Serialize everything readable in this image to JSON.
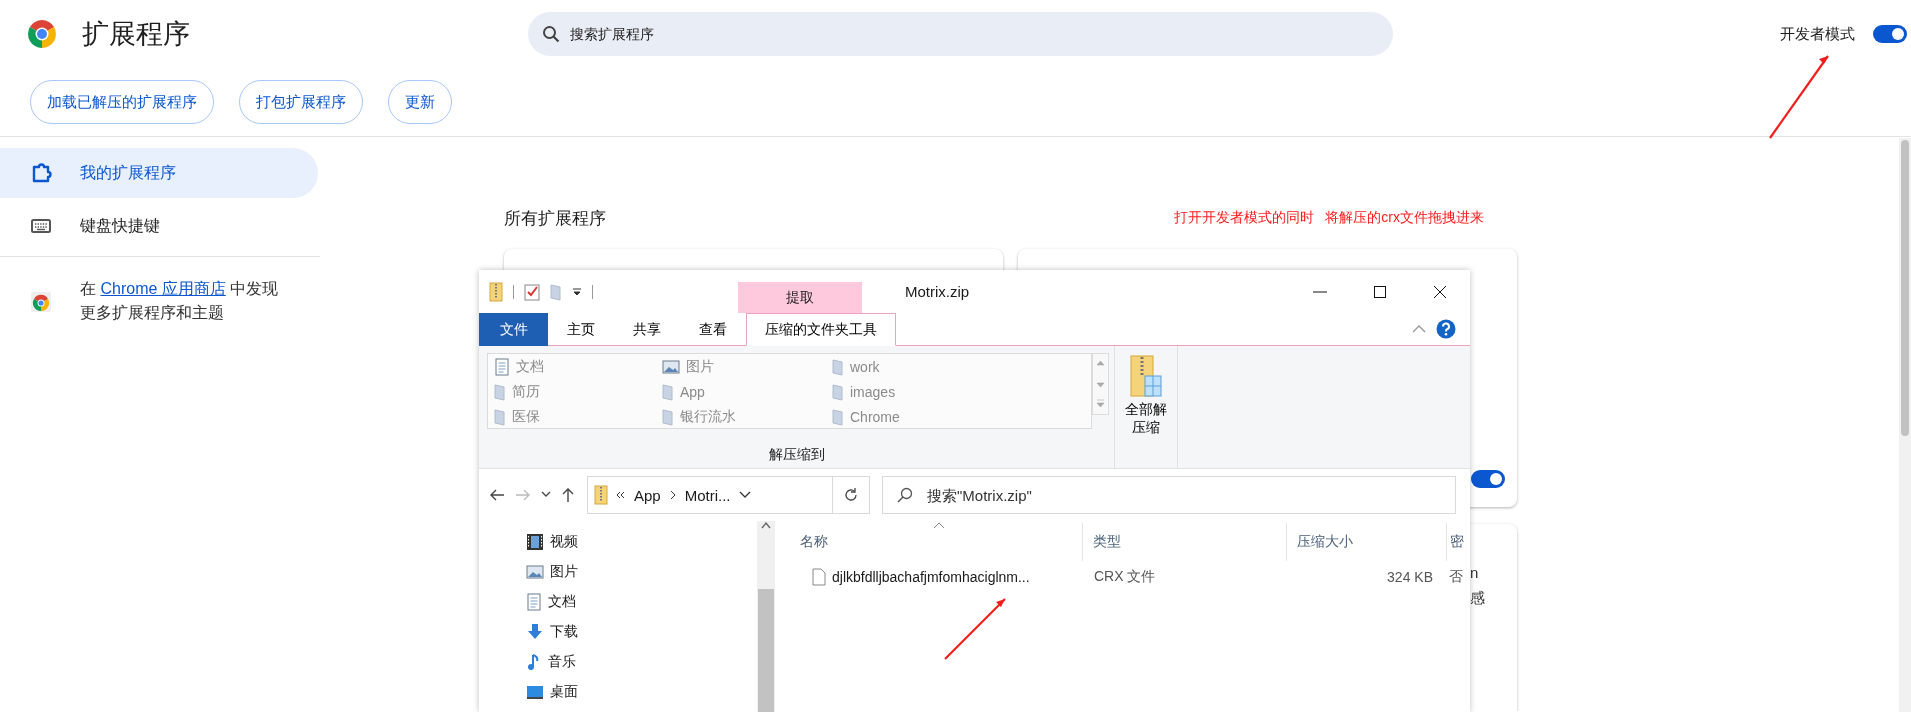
{
  "header": {
    "title": "扩展程序",
    "search": {
      "placeholder": "搜索扩展程序"
    },
    "developer_mode": {
      "label": "开发者模式",
      "on": true
    }
  },
  "toolbar": {
    "buttons": [
      "加载已解压的扩展程序",
      "打包扩展程序",
      "更新"
    ]
  },
  "sidebar": {
    "items": [
      {
        "label": "我的扩展程序",
        "kind": "puzzle",
        "selected": true
      },
      {
        "label": "键盘快捷键",
        "kind": "keyboard",
        "selected": false
      }
    ],
    "store_note": {
      "before": "在 ",
      "link": "Chrome 应用商店",
      "after": " 中发现更多扩展程序和主题"
    }
  },
  "main": {
    "heading": "所有扩展程序",
    "annotation": "打开开发者模式的同时   将解压的crx文件拖拽进来",
    "cards": [
      {
        "kind": "blank"
      },
      {
        "kind": "toggle",
        "on": true
      },
      {
        "kind": "text",
        "lines": [
          "n",
          "感"
        ]
      }
    ]
  },
  "explorer": {
    "context_tab": "提取",
    "title": "Motrix.zip",
    "tabs": [
      {
        "label": "文件",
        "kind": "file",
        "selected": false
      },
      {
        "label": "主页",
        "kind": "plain",
        "selected": false
      },
      {
        "label": "共享",
        "kind": "plain",
        "selected": false
      },
      {
        "label": "查看",
        "kind": "plain",
        "selected": false
      },
      {
        "label": "压缩的文件夹工具",
        "kind": "plain",
        "selected": true
      }
    ],
    "destinations": [
      {
        "label": "文档",
        "kind": "doc"
      },
      {
        "label": "图片",
        "kind": "image"
      },
      {
        "label": "work",
        "kind": "folder"
      },
      {
        "label": "简历",
        "kind": "folder"
      },
      {
        "label": "App",
        "kind": "folder"
      },
      {
        "label": "images",
        "kind": "folder"
      },
      {
        "label": "医保",
        "kind": "folder"
      },
      {
        "label": "银行流水",
        "kind": "folder"
      },
      {
        "label": "Chrome",
        "kind": "folder"
      }
    ],
    "group_label": "解压缩到",
    "extract_all": "全部解压缩",
    "path": [
      "App",
      "Motri..."
    ],
    "search": {
      "placeholder": "搜索\"Motrix.zip\""
    },
    "nav": [
      {
        "label": "视频",
        "kind": "video"
      },
      {
        "label": "图片",
        "kind": "image"
      },
      {
        "label": "文档",
        "kind": "doc"
      },
      {
        "label": "下载",
        "kind": "download"
      },
      {
        "label": "音乐",
        "kind": "music"
      },
      {
        "label": "桌面",
        "kind": "desktop"
      }
    ],
    "columns": [
      "名称",
      "类型",
      "压缩大小",
      "密"
    ],
    "rows": [
      {
        "cells": [
          "djlkbfdlljbachafjmfomhaciglnm...",
          "CRX 文件",
          "324 KB",
          "否"
        ]
      }
    ]
  }
}
